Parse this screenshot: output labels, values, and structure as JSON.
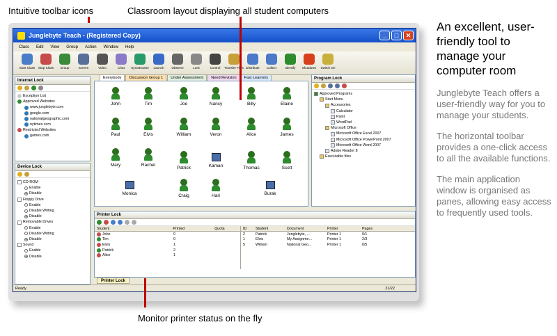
{
  "callouts": {
    "toolbar": "Intuitive toolbar icons",
    "layout": "Classroom layout displaying all student computers",
    "printer": "Monitor printer status on the fly"
  },
  "right": {
    "heading": "An excellent, user-friendly tool to manage your computer room",
    "p1": "Junglebyte Teach offers a user-friendly way for you to manage your students.",
    "p2": "The horizontal toolbar provides a one-click access to all the available functions.",
    "p3": "The main application window is organised as panes, allowing easy access to frequently used tools."
  },
  "window": {
    "title": "Junglebyte Teach - (Registered Copy)"
  },
  "menu": [
    "Class",
    "Edit",
    "View",
    "Group",
    "Action",
    "Window",
    "Help"
  ],
  "toolbar": [
    {
      "label": "Start Class",
      "icon": "start-class-icon",
      "color": "#4a7dc8"
    },
    {
      "label": "Stop Class",
      "icon": "stop-class-icon",
      "color": "#c84a4a"
    },
    {
      "label": "Group",
      "icon": "group-icon",
      "color": "#3a8a3a"
    },
    {
      "label": "Screen",
      "icon": "screen-icon",
      "color": "#5a6e9a"
    },
    {
      "label": "Video",
      "icon": "video-icon",
      "color": "#555555"
    },
    {
      "label": "Chat",
      "icon": "chat-icon",
      "color": "#8a7ac8"
    },
    {
      "label": "SyncBrowse",
      "icon": "syncbrowse-icon",
      "color": "#2a9a6a"
    },
    {
      "label": "Launch",
      "icon": "launch-icon",
      "color": "#3a6ac8"
    },
    {
      "label": "Observe",
      "icon": "observe-icon",
      "color": "#666666"
    },
    {
      "label": "Lock",
      "icon": "lock-icon",
      "color": "#888888"
    },
    {
      "label": "Control",
      "icon": "control-icon",
      "color": "#444444"
    },
    {
      "label": "Transfer Files",
      "icon": "transfer-files-icon",
      "color": "#c8a03a"
    },
    {
      "label": "Distribute",
      "icon": "distribute-icon",
      "color": "#4a7ac8"
    },
    {
      "label": "Collect",
      "icon": "collect-icon",
      "color": "#4a7ac8"
    },
    {
      "label": "Identify",
      "icon": "identify-icon",
      "color": "#2e8b2e"
    },
    {
      "label": "Shutdown",
      "icon": "shutdown-icon",
      "color": "#d8401c"
    },
    {
      "label": "Switch On",
      "icon": "switch-on-icon",
      "color": "#c8b03a"
    }
  ],
  "internet_lock": {
    "title": "Internet Lock",
    "items": [
      "Exception List",
      "Approved Websites",
      "www.junglebyte.com",
      "google.com",
      "nationalgeographic.com",
      "nytimes.com",
      "Restricted Websites",
      "games.com"
    ]
  },
  "device_lock": {
    "title": "Device Lock",
    "items": [
      "CD-ROM",
      "Enable",
      "Disable",
      "Floppy Drive",
      "Enable",
      "Disable Writing",
      "Disable",
      "Removable Drives",
      "Enable",
      "Disable Writing",
      "Disable",
      "Sound",
      "Enable",
      "Disable"
    ]
  },
  "tabs": [
    "Everybody",
    "Discussion Group 1",
    "Under Assessment",
    "Need Revision",
    "Fast Learners"
  ],
  "students": [
    "John",
    "Tim",
    "Joe",
    "Nancy",
    "Billy",
    "Elaine",
    "Paul",
    "Elvis",
    "William",
    "Veron",
    "Alice",
    "James",
    "Mary",
    "Rachel",
    "Patrick",
    "Kaman",
    "Thomas",
    "Scott",
    "Monica",
    "Craig",
    "Hari",
    "Burak"
  ],
  "program_lock": {
    "title": "Program Lock",
    "items": [
      "Approved Programs",
      "Start Menu",
      "Accessories",
      "Calculator",
      "Paint",
      "WordPad",
      "Microsoft Office",
      "Microsoft Office Excel 2007",
      "Microsoft Office PowerPoint 2007",
      "Microsoft Office Word 2007",
      "Adobe Reader 8",
      "Executable files"
    ]
  },
  "printer_lock": {
    "title": "Printer Lock",
    "tab": "Printer Lock",
    "left_headers": [
      "Student",
      "Printed",
      "Quota"
    ],
    "left_rows": [
      [
        "John",
        "0",
        ""
      ],
      [
        "Tim",
        "0",
        ""
      ],
      [
        "Elvis",
        "1",
        ""
      ],
      [
        "Patrick",
        "2",
        ""
      ],
      [
        "Alice",
        "1",
        ""
      ]
    ],
    "right_headers": [
      "ID",
      "Student",
      "Document",
      "Printer",
      "Pages"
    ],
    "right_rows": [
      [
        "2",
        "Patrick",
        "Junglebyte, ...",
        "Printer 1",
        "0/1"
      ],
      [
        "1",
        "Elvis",
        "My Assignme...",
        "Printer 1",
        "2/3"
      ],
      [
        "5",
        "William",
        "National Geo...",
        "Printer 1",
        "0/5"
      ]
    ]
  },
  "status": {
    "left": "Ready",
    "right": "21/22"
  }
}
